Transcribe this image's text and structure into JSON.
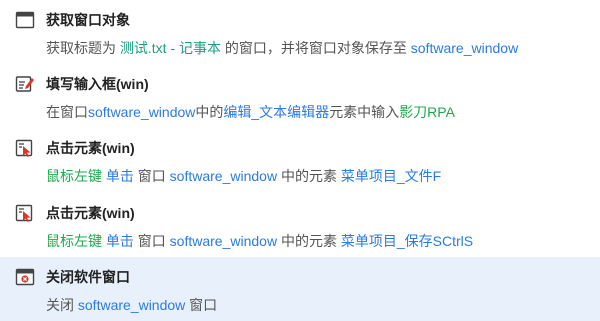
{
  "steps": [
    {
      "title": "获取窗口对象",
      "icon": "window-icon",
      "desc": [
        {
          "text": "获取标题为 ",
          "style": "plain"
        },
        {
          "text": "测试.txt - 记事本",
          "style": "teal"
        },
        {
          "text": " 的窗口，并将窗口对象保存至 ",
          "style": "plain"
        },
        {
          "text": "software_window",
          "style": "blue"
        }
      ]
    },
    {
      "title": "填写输入框(win)",
      "icon": "edit-input-icon",
      "desc": [
        {
          "text": "在窗口",
          "style": "plain"
        },
        {
          "text": "software_window",
          "style": "blue"
        },
        {
          "text": "中的",
          "style": "plain"
        },
        {
          "text": "编辑_文本编辑器",
          "style": "blue"
        },
        {
          "text": "元素中输入",
          "style": "plain"
        },
        {
          "text": "影刀RPA",
          "style": "green"
        }
      ]
    },
    {
      "title": "点击元素(win)",
      "icon": "click-element-icon",
      "desc": [
        {
          "text": "鼠标左键",
          "style": "green"
        },
        {
          "text": " ",
          "style": "plain"
        },
        {
          "text": "单击",
          "style": "blue"
        },
        {
          "text": " 窗口 ",
          "style": "plain"
        },
        {
          "text": "software_window",
          "style": "blue"
        },
        {
          "text": " 中的元素 ",
          "style": "plain"
        },
        {
          "text": "菜单项目_文件F",
          "style": "blue"
        }
      ]
    },
    {
      "title": "点击元素(win)",
      "icon": "click-element-icon",
      "desc": [
        {
          "text": "鼠标左键",
          "style": "green"
        },
        {
          "text": " ",
          "style": "plain"
        },
        {
          "text": "单击",
          "style": "blue"
        },
        {
          "text": " 窗口 ",
          "style": "plain"
        },
        {
          "text": "software_window",
          "style": "blue"
        },
        {
          "text": " 中的元素 ",
          "style": "plain"
        },
        {
          "text": "菜单项目_保存SCtrlS",
          "style": "blue"
        }
      ]
    },
    {
      "title": "关闭软件窗口",
      "icon": "close-window-icon",
      "desc": [
        {
          "text": "关闭 ",
          "style": "plain"
        },
        {
          "text": "software_window",
          "style": "blue"
        },
        {
          "text": " 窗口",
          "style": "plain"
        }
      ]
    }
  ],
  "colors": {
    "selected_background": "#e8f0fb",
    "text_blue": "#2b7be0",
    "text_teal": "#1f9e84",
    "text_green": "#1fa84c",
    "icon_red": "#d9362b"
  }
}
